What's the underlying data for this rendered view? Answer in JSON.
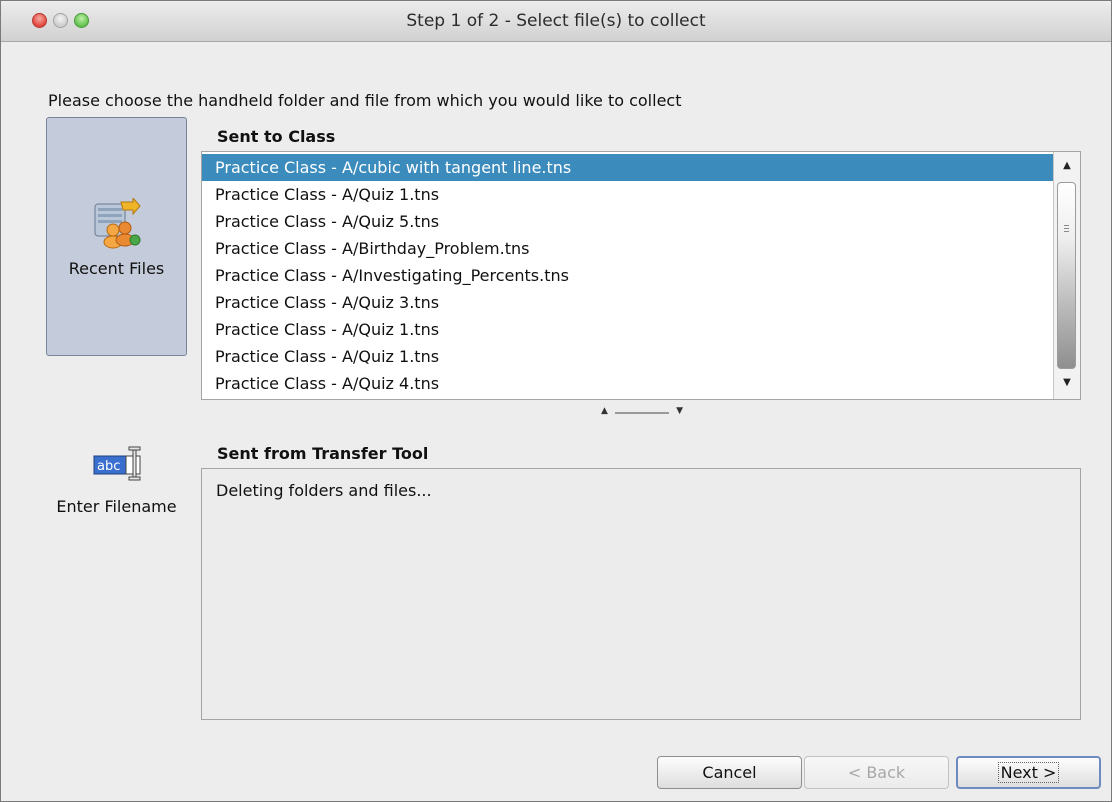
{
  "window": {
    "title": "Step 1 of 2 - Select file(s) to collect"
  },
  "instruction": "Please choose the handheld folder and file from which you would like to collect",
  "nav": {
    "recent_files": {
      "label": "Recent Files",
      "icon": "recent-files-icon"
    },
    "enter_filename": {
      "label": "Enter Filename",
      "icon": "text-field-cursor-icon"
    }
  },
  "sent_to_class": {
    "label": "Sent to Class",
    "selected_index": 0,
    "files": [
      "Practice Class - A/cubic with tangent line.tns",
      "Practice Class - A/Quiz 1.tns",
      "Practice Class - A/Quiz 5.tns",
      "Practice Class - A/Birthday_Problem.tns",
      "Practice Class - A/Investigating_Percents.tns",
      "Practice Class - A/Quiz 3.tns",
      "Practice Class - A/Quiz 1.tns",
      "Practice Class - A/Quiz 1.tns",
      "Practice Class - A/Quiz 4.tns"
    ]
  },
  "sent_from_transfer_tool": {
    "label": "Sent from Transfer Tool",
    "status": "Deleting folders and files..."
  },
  "buttons": {
    "cancel": "Cancel",
    "back": "< Back",
    "next": "Next >"
  },
  "colors": {
    "selection": "#3b8bbd",
    "nav_selected": "#c4cbda"
  }
}
